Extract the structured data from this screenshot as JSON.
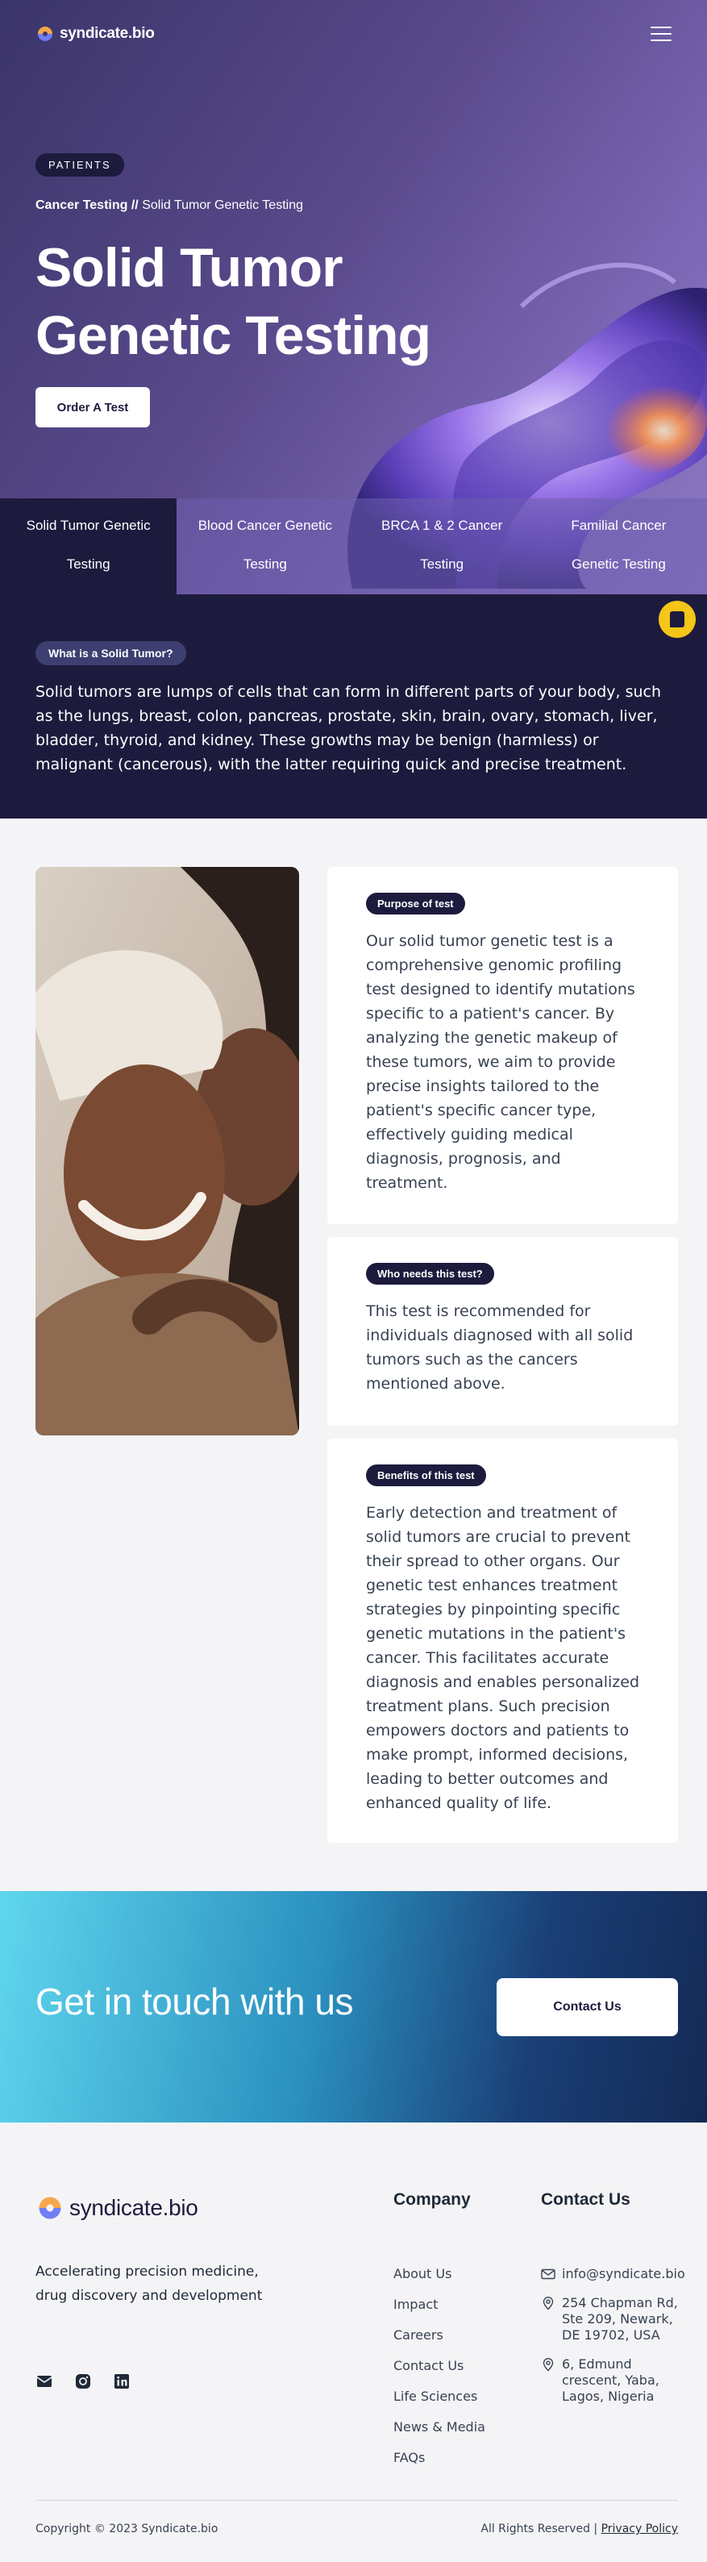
{
  "brand": {
    "name": "syndicate.bio"
  },
  "hero": {
    "badge": "PATIENTS",
    "breadcrumb_parent": "Cancer Testing //",
    "breadcrumb_current": "Solid Tumor Genetic Testing",
    "title_line1": "Solid Tumor",
    "title_line2": "Genetic Testing",
    "cta": "Order A Test"
  },
  "tabs": [
    {
      "line1": "Solid Tumor Genetic",
      "line2": "Testing",
      "active": true
    },
    {
      "line1": "Blood Cancer Genetic",
      "line2": "Testing",
      "active": false
    },
    {
      "line1": "BRCA 1 & 2 Cancer",
      "line2": "Testing",
      "active": false
    },
    {
      "line1": "Familial Cancer",
      "line2": "Genetic Testing",
      "active": false
    }
  ],
  "whatis": {
    "label": "What is a Solid Tumor?",
    "text": "Solid tumors are lumps of cells that can form in different parts of your body, such as the lungs, breast, colon, pancreas, prostate, skin, brain, ovary, stomach, liver, bladder, thyroid, and kidney. These growths may be benign (harmless) or malignant (cancerous), with the latter requiring quick and precise treatment."
  },
  "cards": [
    {
      "label": "Purpose of test",
      "text": "Our solid tumor genetic test is a comprehensive genomic profiling test designed to identify mutations specific to a patient's cancer. By analyzing the genetic makeup of these tumors, we aim to provide precise insights tailored to the patient's specific cancer type, effectively guiding medical diagnosis, prognosis, and treatment."
    },
    {
      "label": "Who needs this test?",
      "text": "This test is recommended for individuals diagnosed with all solid tumors such as the cancers mentioned above."
    },
    {
      "label": "Benefits of this test",
      "text": "Early detection and treatment of solid tumors are crucial to prevent their spread to other organs. Our genetic test enhances treatment strategies by pinpointing specific genetic mutations in the patient's cancer. This facilitates accurate diagnosis and enables personalized treatment plans. Such precision empowers doctors and patients to make prompt, informed decisions, leading to better outcomes and enhanced quality of life."
    }
  ],
  "contact": {
    "heading": "Get in touch with us",
    "button": "Contact Us"
  },
  "footer": {
    "tagline": "Accelerating precision medicine, drug discovery and development",
    "company_title": "Company",
    "contact_title": "Contact Us",
    "links": [
      "About Us",
      "Impact",
      "Careers",
      "Contact Us",
      "Life Sciences",
      "News & Media",
      "FAQs"
    ],
    "email": "info@syndicate.bio",
    "address1": "254 Chapman Rd, Ste 209, Newark, DE 19702, USA",
    "address2": "6, Edmund crescent, Yaba, Lagos, Nigeria",
    "copyright": "Copyright © 2023 Syndicate.bio",
    "rights": "All Rights Reserved |",
    "privacy": "Privacy Policy"
  },
  "icons": [
    "menu-icon",
    "chat-icon",
    "email-icon",
    "instagram-icon",
    "linkedin-icon",
    "mail-icon",
    "location-icon"
  ],
  "colors": {
    "navy": "#1d1b3d",
    "accent_yellow": "#f5c518",
    "hero_purple": "#5a4a8c",
    "contact_cyan": "#5fd6ee"
  }
}
